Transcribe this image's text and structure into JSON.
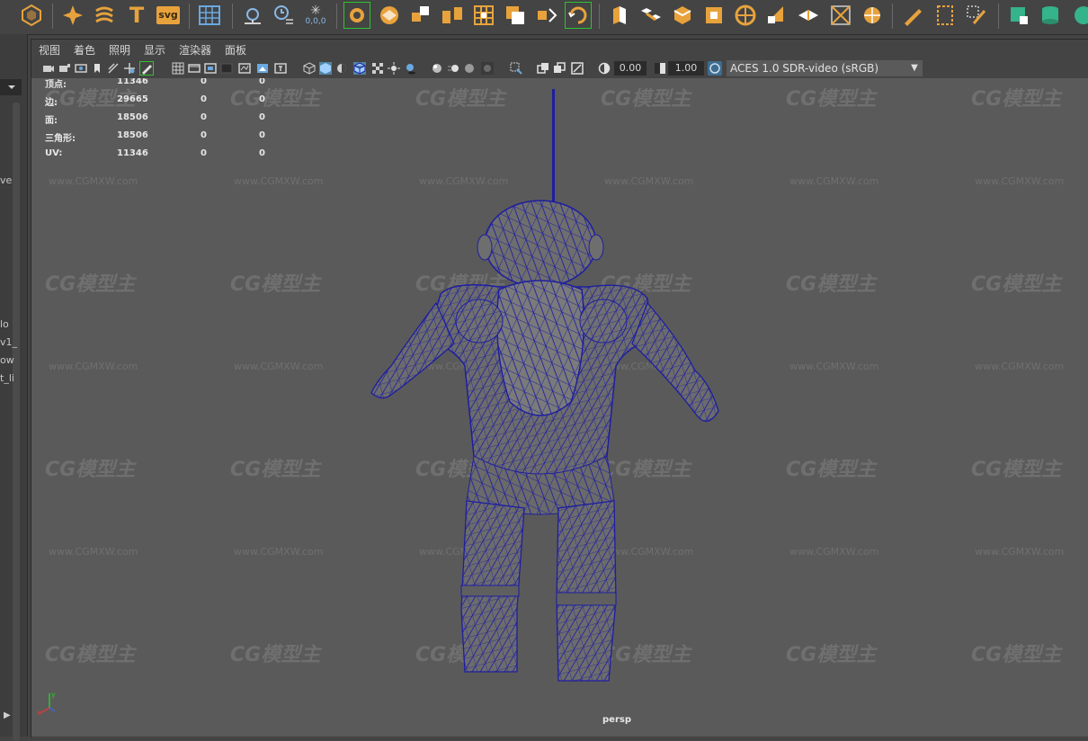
{
  "shelf": {
    "tools": [
      {
        "icon": "polygon-sphere-icon"
      },
      {
        "icon": "star-icon"
      },
      {
        "icon": "sweep-mesh-icon"
      },
      {
        "icon": "type-tool-icon",
        "label": "T"
      },
      {
        "icon": "svg-tool-icon",
        "label": "svg"
      },
      {
        "icon": "grid-icon"
      },
      {
        "icon": "camera-focus-icon"
      },
      {
        "icon": "time-icon"
      },
      {
        "icon": "snowflake-icon",
        "label": "0,0,0"
      },
      {
        "icon": "sculpt-icon"
      },
      {
        "icon": "smooth-icon"
      },
      {
        "icon": "combine-icon"
      },
      {
        "icon": "separate-icon"
      },
      {
        "icon": "extract-icon"
      },
      {
        "icon": "boolean-icon"
      },
      {
        "icon": "mirror-icon"
      },
      {
        "icon": "retopo-icon"
      },
      {
        "icon": "extrude-icon"
      },
      {
        "icon": "bridge-icon"
      },
      {
        "icon": "bevel-icon"
      },
      {
        "icon": "fill-hole-icon"
      },
      {
        "icon": "insert-edge-icon"
      },
      {
        "icon": "wedge-icon"
      },
      {
        "icon": "poke-icon"
      },
      {
        "icon": "target-weld-icon"
      },
      {
        "icon": "pen-icon"
      },
      {
        "icon": "crop-icon"
      },
      {
        "icon": "edit-pen-icon"
      },
      {
        "icon": "uv-cube-icon"
      },
      {
        "icon": "cylinder-icon"
      },
      {
        "icon": "sphere-half-icon"
      }
    ]
  },
  "left_strip": {
    "snippets": [
      "ve",
      "lo",
      "v1_",
      "ow",
      "t_li"
    ]
  },
  "panel": {
    "menu": [
      "视图",
      "着色",
      "照明",
      "显示",
      "渲染器",
      "面板"
    ],
    "toolbar": {
      "gamma_value": "0.00",
      "exposure_value": "1.00",
      "color_space": "ACES 1.0 SDR-video (sRGB)"
    }
  },
  "hud": {
    "rows": [
      {
        "label": "顶点:",
        "a": "11346",
        "b": "0",
        "c": "0"
      },
      {
        "label": "边:",
        "a": "29665",
        "b": "0",
        "c": "0"
      },
      {
        "label": "面:",
        "a": "18506",
        "b": "0",
        "c": "0"
      },
      {
        "label": "三角形:",
        "a": "18506",
        "b": "0",
        "c": "0"
      },
      {
        "label": "UV:",
        "a": "11346",
        "b": "0",
        "c": "0"
      }
    ]
  },
  "viewport": {
    "camera": "persp",
    "watermark_logo": "CG模型主",
    "watermark_url": "www.CGMXW.com"
  },
  "colors": {
    "wire": "#1e1ea0",
    "viewport_bg": "#5a5a5a",
    "accent_orange": "#e8a23c",
    "accent_teal": "#35b38a"
  }
}
